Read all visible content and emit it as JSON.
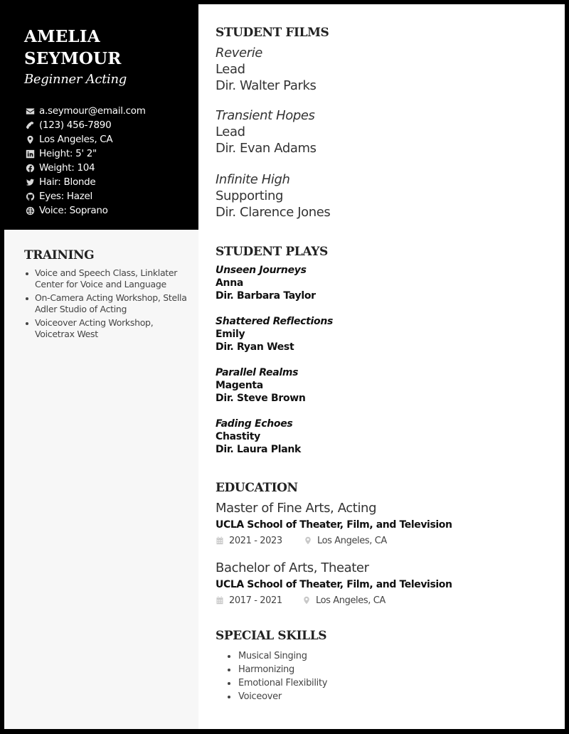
{
  "header": {
    "name_line1": "AMELIA",
    "name_line2": "SEYMOUR",
    "subtitle": "Beginner Acting"
  },
  "contacts": [
    {
      "icon": "envelope-icon",
      "text": "a.seymour@email.com"
    },
    {
      "icon": "phone-icon",
      "text": "(123) 456-7890"
    },
    {
      "icon": "map-pin-icon",
      "text": "Los Angeles, CA"
    },
    {
      "icon": "linkedin-icon",
      "text": "Height: 5' 2\""
    },
    {
      "icon": "facebook-icon",
      "text": "Weight: 104"
    },
    {
      "icon": "twitter-icon",
      "text": "Hair: Blonde"
    },
    {
      "icon": "github-icon",
      "text": "Eyes: Hazel"
    },
    {
      "icon": "globe-icon",
      "text": "Voice: Soprano"
    }
  ],
  "training": {
    "title": "TRAINING",
    "items": [
      "Voice and Speech Class, Linklater Center for Voice and Language",
      "On-Camera Acting Workshop, Stella Adler Studio of Acting",
      "Voiceover Acting Workshop, Voicetrax West"
    ]
  },
  "student_films": {
    "title": "STUDENT FILMS",
    "items": [
      {
        "title": "Reverie",
        "role": "Lead",
        "director": "Dir. Walter Parks"
      },
      {
        "title": "Transient Hopes",
        "role": "Lead",
        "director": "Dir. Evan Adams"
      },
      {
        "title": "Infinite High",
        "role": "Supporting",
        "director": "Dir. Clarence Jones"
      }
    ]
  },
  "student_plays": {
    "title": "STUDENT PLAYS",
    "items": [
      {
        "title": "Unseen Journeys",
        "role": "Anna",
        "director": "Dir. Barbara Taylor"
      },
      {
        "title": "Shattered Reflections",
        "role": "Emily",
        "director": "Dir. Ryan West"
      },
      {
        "title": "Parallel Realms",
        "role": "Magenta",
        "director": "Dir. Steve Brown"
      },
      {
        "title": "Fading Echoes",
        "role": "Chastity",
        "director": "Dir. Laura Plank"
      }
    ]
  },
  "education": {
    "title": "EDUCATION",
    "items": [
      {
        "degree": "Master of Fine Arts, Acting",
        "school": "UCLA School of Theater, Film, and Television",
        "dates": "2021 - 2023",
        "location": "Los Angeles, CA"
      },
      {
        "degree": "Bachelor of Arts, Theater",
        "school": "UCLA School of Theater, Film, and Television",
        "dates": "2017 - 2021",
        "location": "Los Angeles, CA"
      }
    ]
  },
  "special_skills": {
    "title": "SPECIAL SKILLS",
    "items": [
      "Musical Singing",
      "Harmonizing",
      "Emotional Flexibility",
      "Voiceover"
    ]
  }
}
